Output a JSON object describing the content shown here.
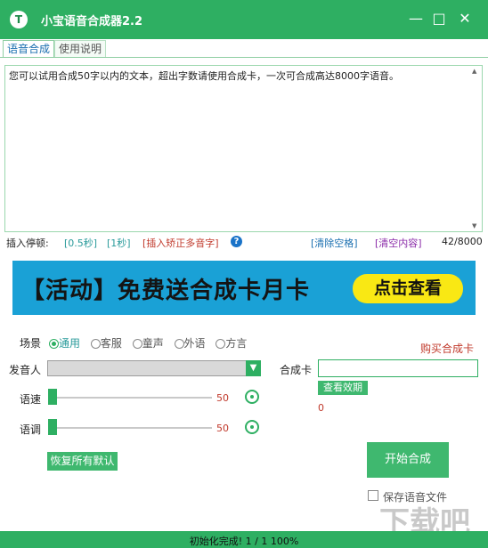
{
  "window": {
    "title": "小宝语音合成器2.2",
    "logo_letter": "T"
  },
  "tabs": [
    {
      "label": "语音合成"
    },
    {
      "label": "使用说明"
    }
  ],
  "textarea": {
    "value": "您可以试用合成50字以内的文本，超出字数请使用合成卡，一次可合成高达8000字语音。"
  },
  "insert": {
    "label": "插入停顿:",
    "pause_half": "[0.5秒]",
    "pause_one": "[1秒]",
    "polyphone": "[插入矫正多音字]",
    "clear_spaces": "[清除空格]",
    "clear_content": "[清空内容]",
    "char_count": "42/8000"
  },
  "banner": {
    "text": "【活动】免费送合成卡月卡",
    "button": "点击查看"
  },
  "scene": {
    "label": "场景",
    "options": [
      "通用",
      "客服",
      "童声",
      "外语",
      "方言"
    ],
    "selected": 0
  },
  "buy_card": "购买合成卡",
  "speaker": {
    "label": "发音人",
    "value": ""
  },
  "card": {
    "label": "合成卡",
    "value": "",
    "check_button": "查看效期",
    "remaining": "0"
  },
  "speed": {
    "label": "语速",
    "value": "50"
  },
  "tone": {
    "label": "语调",
    "value": "50"
  },
  "restore_button": "恢复所有默认",
  "start_button": "开始合成",
  "save_audio": {
    "label": "保存语音文件",
    "checked": false
  },
  "status": "初始化完成! 1 / 1   100%",
  "colors": {
    "accent": "#2eaf62",
    "banner_bg": "#1aa1d6",
    "banner_button": "#f9e814",
    "warning": "#c0392b"
  }
}
